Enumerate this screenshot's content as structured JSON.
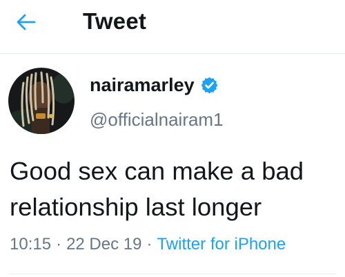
{
  "header": {
    "back_icon": "arrow-left-icon",
    "title": "Tweet"
  },
  "author": {
    "display_name": "nairamarley",
    "verified": true,
    "handle": "@officialnairam1"
  },
  "tweet": {
    "text": "Good sex can make a bad relationship last longer",
    "time": "10:15",
    "separator": "·",
    "date": "22 Dec 19",
    "source": "Twitter for iPhone"
  },
  "colors": {
    "accent": "#1da1f2",
    "text_primary": "#14171a",
    "text_secondary": "#657786",
    "divider": "#e6ecf0"
  }
}
